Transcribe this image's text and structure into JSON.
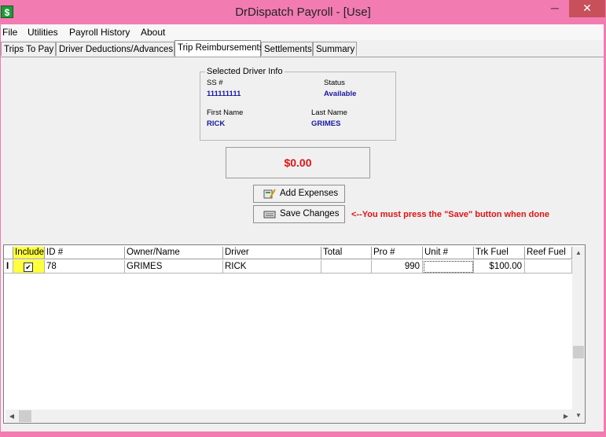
{
  "window": {
    "app_icon": "$",
    "title": "DrDispatch Payroll - [Use]",
    "min": "─",
    "max": "□",
    "close": "✕"
  },
  "menu": [
    {
      "label": "File"
    },
    {
      "label": "Utilities"
    },
    {
      "label": "Payroll History"
    },
    {
      "label": "About"
    }
  ],
  "tabs": [
    {
      "label": "Trips To Pay"
    },
    {
      "label": "Driver Deductions/Advances"
    },
    {
      "label": "Trip Reimbursements",
      "active": true
    },
    {
      "label": "Settlements"
    },
    {
      "label": "Summary"
    }
  ],
  "driver_info": {
    "title": "Selected Driver Info",
    "ss_label": "SS #",
    "ss_value": "111111111",
    "status_label": "Status",
    "status_value": "Available",
    "first_label": "First Name",
    "first_value": "RICK",
    "last_label": "Last Name",
    "last_value": "GRIMES"
  },
  "total_amount": "$0.00",
  "buttons": {
    "add_expenses": "Add Expenses",
    "save_changes": "Save Changes"
  },
  "save_hint": "<--You must press the \"Save\" button when done",
  "grid": {
    "columns": [
      "Include",
      "ID #",
      "Owner/Name",
      "Driver",
      "Total",
      "Pro #",
      "Unit #",
      "Trk Fuel",
      "Reef Fuel"
    ],
    "rows": [
      {
        "indicator": "I",
        "include": "✔",
        "id": "78",
        "owner": "GRIMES",
        "driver": "RICK",
        "total": "",
        "pro": "990",
        "unit": "",
        "trk_fuel": "$100.00",
        "reef_fuel": ""
      }
    ]
  },
  "scroll": {
    "up": "▲",
    "down": "▼",
    "left": "◀",
    "right": "▶"
  }
}
